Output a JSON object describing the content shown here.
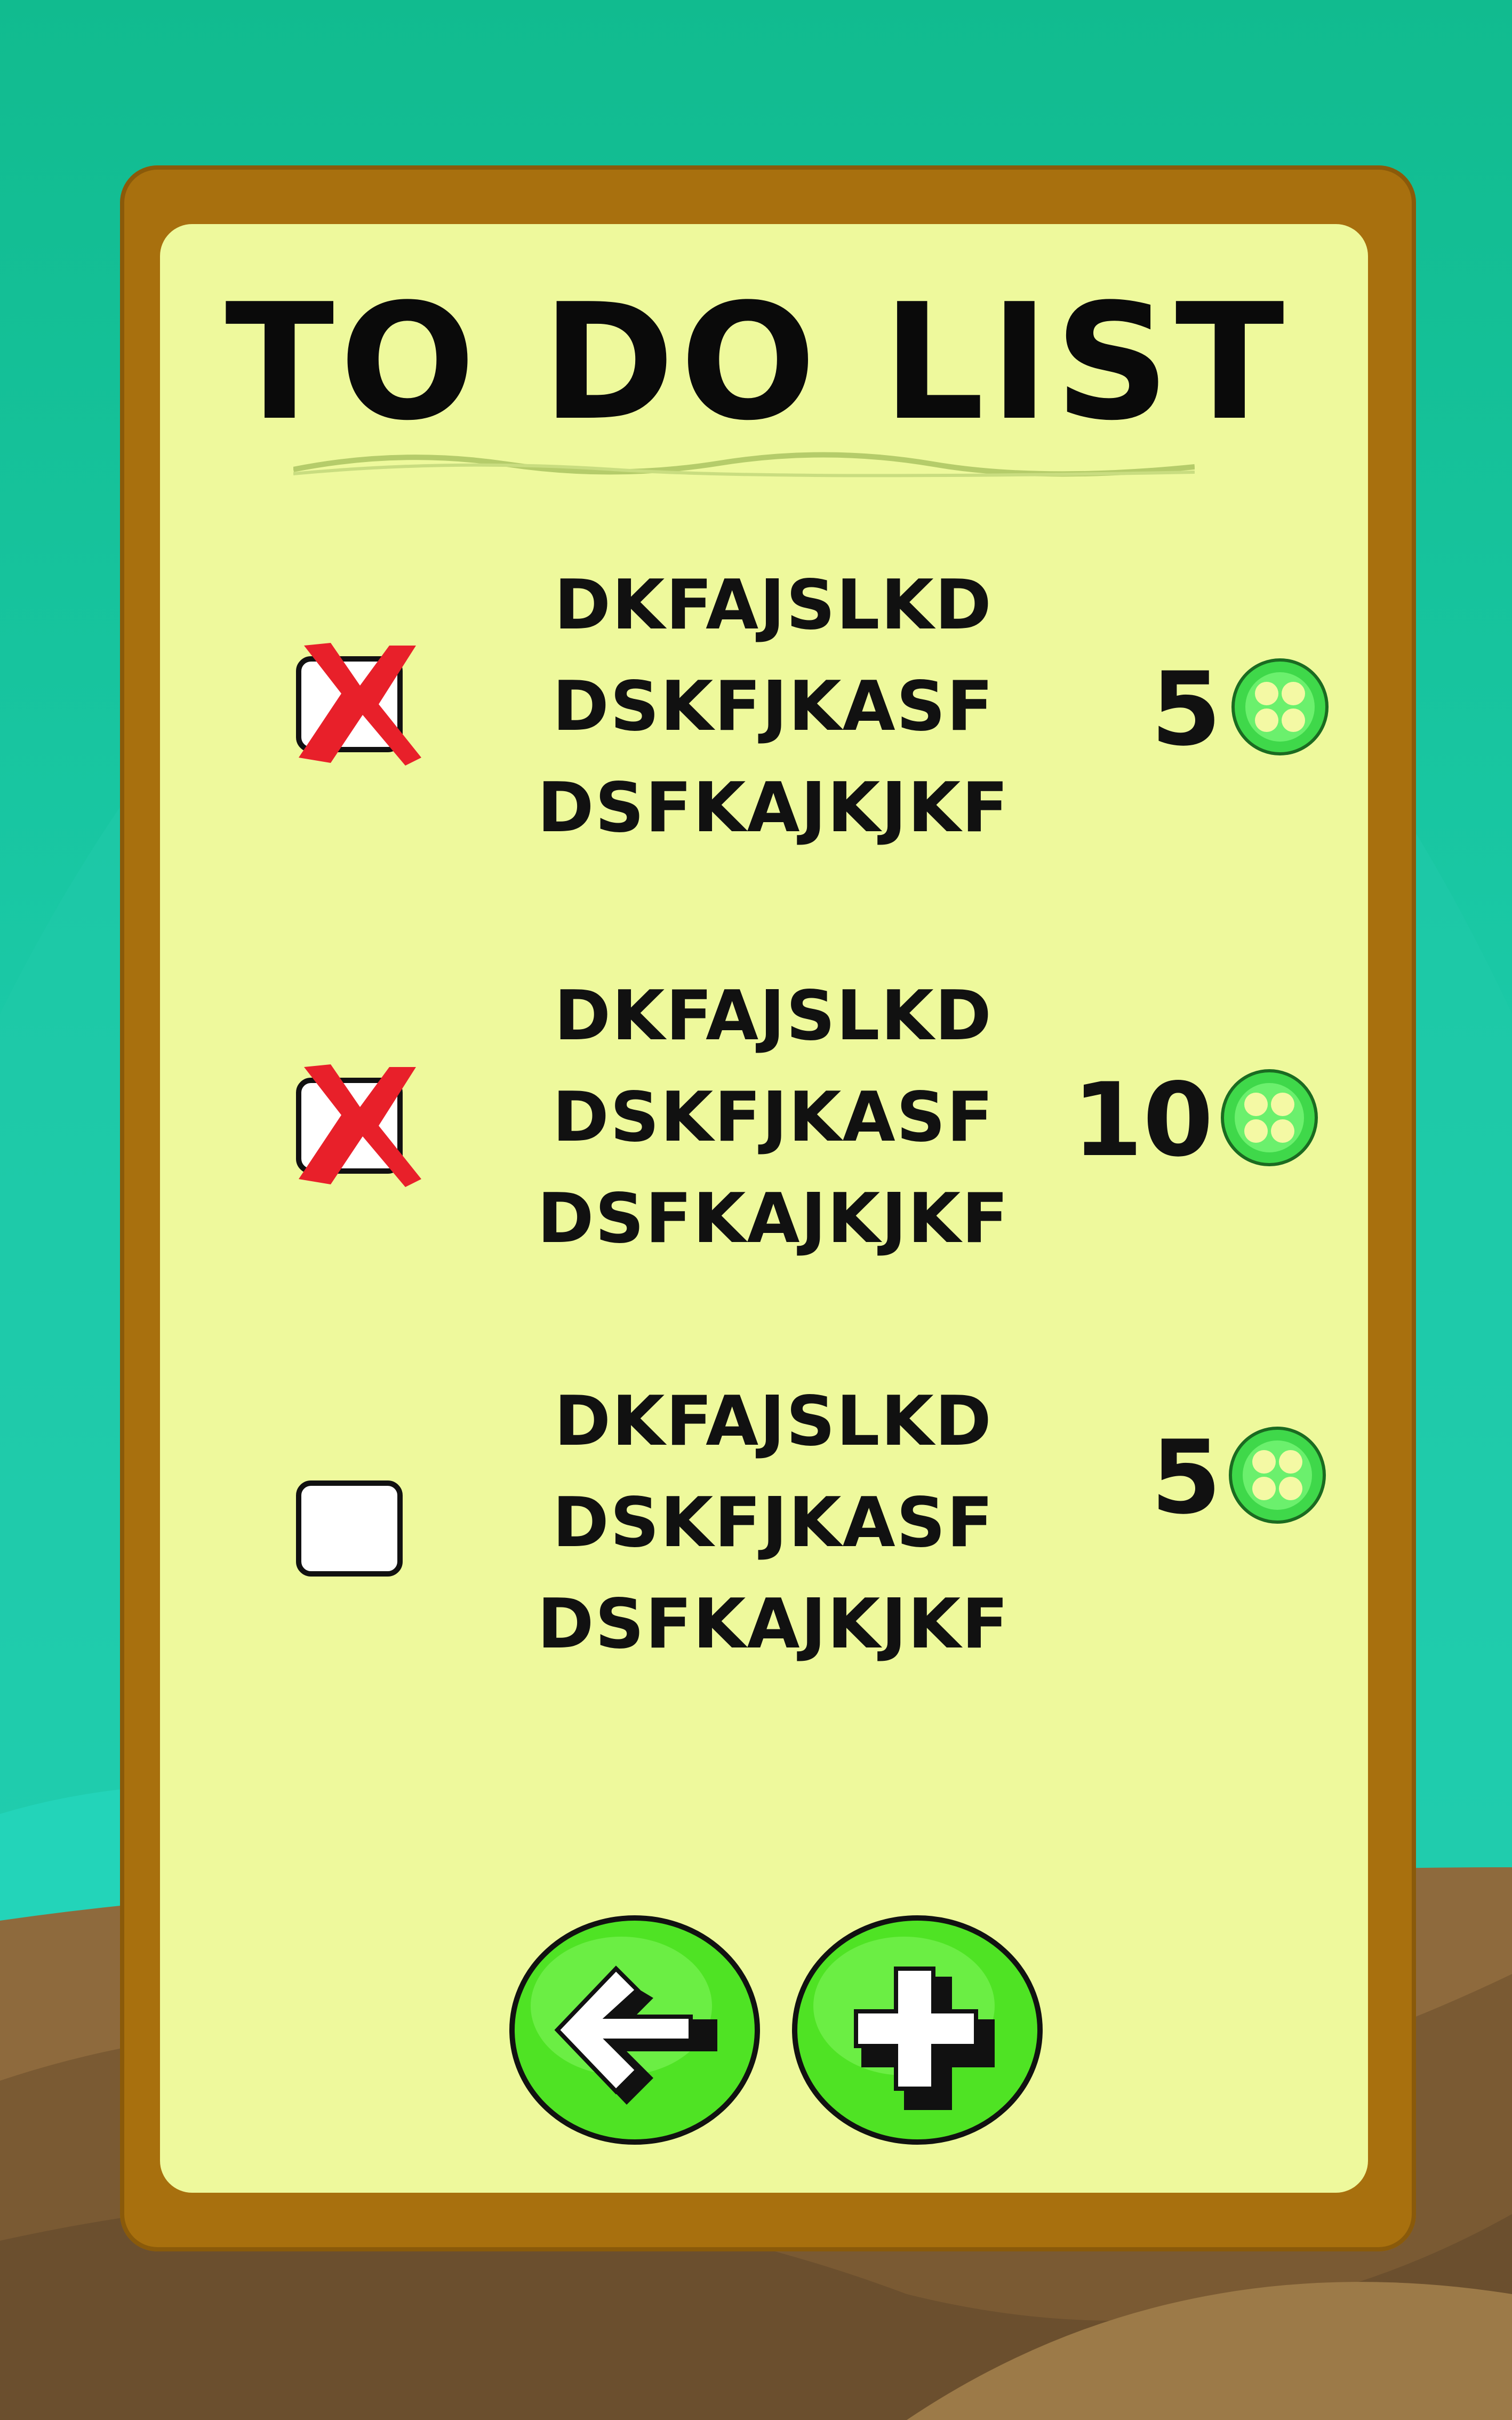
{
  "title": "TO DO LIST",
  "tasks": [
    {
      "lines": [
        "DKFAJSLKD",
        "DSKFJKASF",
        "DSFKAJKJKF"
      ],
      "points": "5",
      "checked": true
    },
    {
      "lines": [
        "DKFAJSLKD",
        "DSKFJKASF",
        "DSFKAJKJKF"
      ],
      "points": "10",
      "checked": true
    },
    {
      "lines": [
        "DKFAJSLKD",
        "DSKFJKASF",
        "DSFKAJKJKF"
      ],
      "points": "5",
      "checked": false
    }
  ],
  "icons": {
    "coin": "button-coin-icon",
    "back": "back-arrow-icon",
    "add": "plus-icon",
    "check": "x-mark-icon"
  },
  "colors": {
    "sky": "#13bd94",
    "paper": "#eef99c",
    "board": "#a8700e",
    "button_green": "#4fe324",
    "x_red": "#e8202a"
  }
}
